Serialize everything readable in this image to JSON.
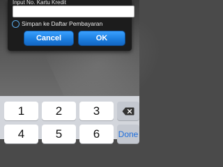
{
  "dialog": {
    "field_label": "Input No. Kartu Kredit",
    "card_number_value": "",
    "save_checkbox_label": "Simpan ke Daftar Pembayaran",
    "cancel_label": "Cancel",
    "ok_label": "OK"
  },
  "keyboard": {
    "row1": [
      "1",
      "2",
      "3"
    ],
    "row2": [
      "4",
      "5",
      "6"
    ],
    "backspace_icon": "backspace-icon",
    "done_label": "Done"
  },
  "colors": {
    "button_blue": "#1d7fe0",
    "dialog_bg": "#1c1c1c",
    "keyboard_bg": "#d3d6dc",
    "done_text": "#1d6ddc"
  }
}
